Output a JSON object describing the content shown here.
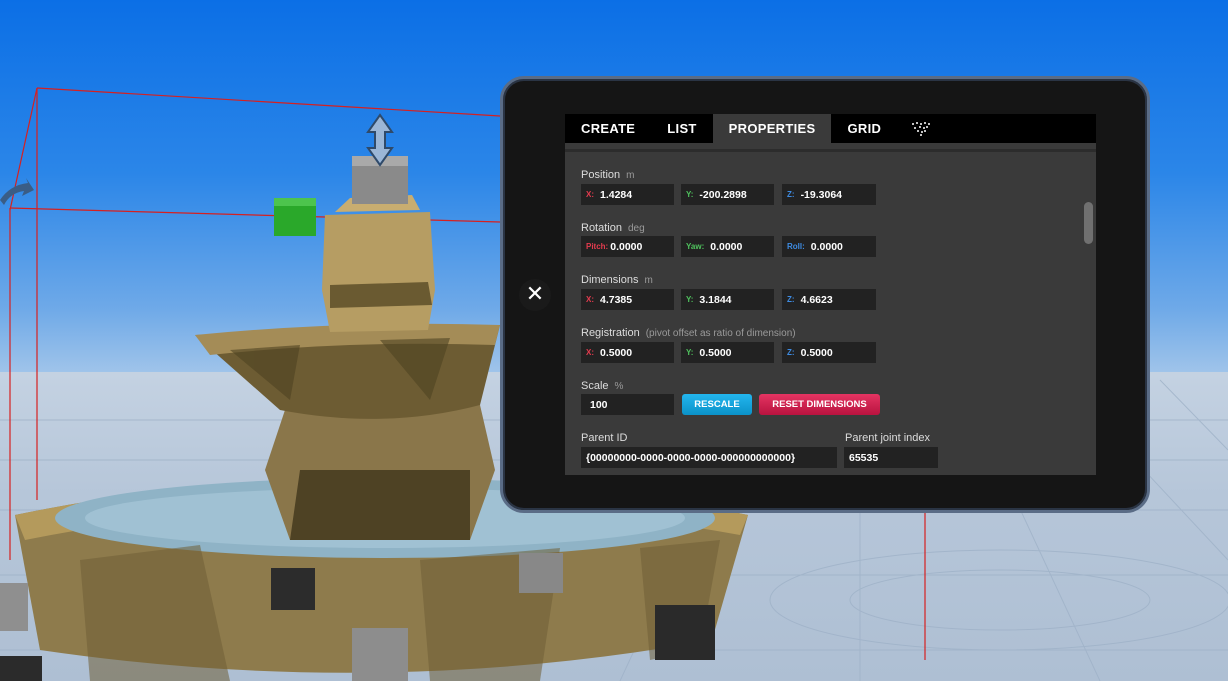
{
  "tabs": [
    {
      "label": "CREATE"
    },
    {
      "label": "LIST"
    },
    {
      "label": "PROPERTIES"
    },
    {
      "label": "GRID"
    }
  ],
  "active_tab": "PROPERTIES",
  "tab_icon": "particles-icon",
  "properties": {
    "position": {
      "label": "Position",
      "unit": "m",
      "x_label": "X:",
      "x": "1.4284",
      "y_label": "Y:",
      "y": "-200.2898",
      "z_label": "Z:",
      "z": "-19.3064"
    },
    "rotation": {
      "label": "Rotation",
      "unit": "deg",
      "pitch_label": "Pitch:",
      "pitch": "0.0000",
      "yaw_label": "Yaw:",
      "yaw": "0.0000",
      "roll_label": "Roll:",
      "roll": "0.0000"
    },
    "dimensions": {
      "label": "Dimensions",
      "unit": "m",
      "x_label": "X:",
      "x": "4.7385",
      "y_label": "Y:",
      "y": "3.1844",
      "z_label": "Z:",
      "z": "4.6623"
    },
    "registration": {
      "label": "Registration",
      "unit": "(pivot offset as ratio of dimension)",
      "x_label": "X:",
      "x": "0.5000",
      "y_label": "Y:",
      "y": "0.5000",
      "z_label": "Z:",
      "z": "0.5000"
    },
    "scale": {
      "label": "Scale",
      "unit": "%",
      "value": "100",
      "rescale_label": "RESCALE",
      "reset_label": "RESET DIMENSIONS"
    },
    "parent": {
      "id_label": "Parent ID",
      "id": "{00000000-0000-0000-0000-000000000000}",
      "joint_label": "Parent joint index",
      "joint": "65535"
    }
  },
  "colors": {
    "axis_x": "#e33b4e",
    "axis_y": "#4fc35d",
    "axis_z": "#3e8ce3",
    "rescale": "#1aa9e2",
    "reset": "#d4234f",
    "tablet_bezel": "#151515",
    "panel_bg": "#3a3a3a"
  }
}
